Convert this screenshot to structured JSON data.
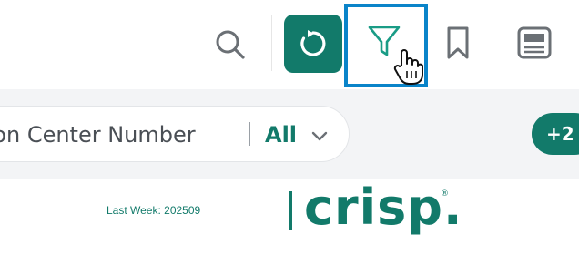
{
  "toolbar": {
    "search_icon": "search-icon",
    "refresh_icon": "refresh-icon",
    "filter_icon": "filter-icon",
    "bookmark_icon": "bookmark-icon",
    "layout_icon": "layout-icon",
    "accent_color": "#127a6a",
    "focus_color": "#0a84c9"
  },
  "filter_bar": {
    "pill_label": "ution Center Number",
    "pill_value": "All",
    "more_count": "+2"
  },
  "footer": {
    "last_week": "Last Week: 202509",
    "logo_text": "crisp.",
    "logo_reg": "®"
  }
}
